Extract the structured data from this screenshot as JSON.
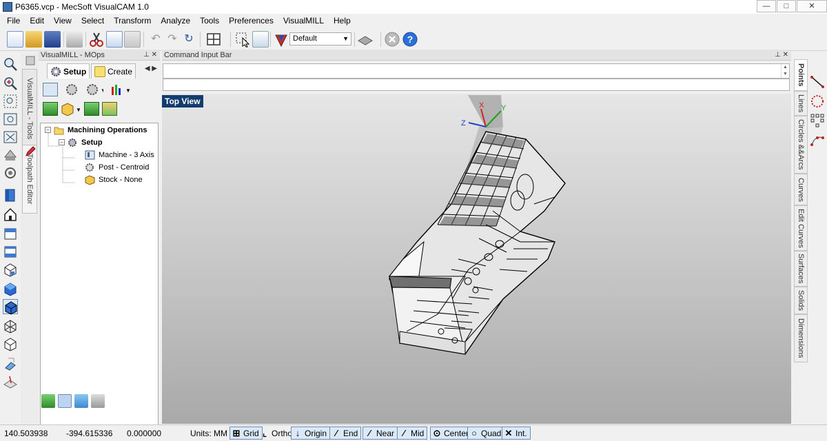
{
  "window": {
    "title": "P6365.vcp - MecSoft VisualCAM 1.0",
    "min": "—",
    "max": "□",
    "close": "✕"
  },
  "menu": [
    "File",
    "Edit",
    "View",
    "Select",
    "Transform",
    "Analyze",
    "Tools",
    "Preferences",
    "VisualMILL",
    "Help"
  ],
  "toolbar": {
    "layer_combo": "Default"
  },
  "left_vtabs": {
    "tools": "VisualMILL - Tools",
    "toolpath_editor": "Toolpath Editor"
  },
  "mops_panel": {
    "title": "VisualMILL - MOps",
    "tabs": {
      "setup": "Setup",
      "create": "Create"
    },
    "tree": {
      "root": "Machining Operations",
      "setup": "Setup",
      "machine": "Machine - 3 Axis",
      "post": "Post - Centroid",
      "stock": "Stock - None"
    }
  },
  "command_bar": {
    "title": "Command Input Bar"
  },
  "viewport": {
    "label": "Top View",
    "axes": {
      "x": "X",
      "y": "Y",
      "z": "Z"
    }
  },
  "right_vtabs": [
    "Points",
    "Lines",
    "Circles &&Arcs",
    "Curves",
    "Edit Curves",
    "Surfaces",
    "Solids",
    "Dimensions"
  ],
  "status": {
    "x": "140.503938",
    "y": "-394.615336",
    "z": "0.000000",
    "units": "Units: MM",
    "snaps": [
      "Grid",
      "Ortho",
      "Origin",
      "End",
      "Near",
      "Mid",
      "Center",
      "Quad",
      "Int."
    ]
  },
  "colors": {
    "view_label_bg": "#123b6e",
    "axis_x": "#d62020",
    "axis_y": "#20a020",
    "axis_z": "#2040d0"
  }
}
